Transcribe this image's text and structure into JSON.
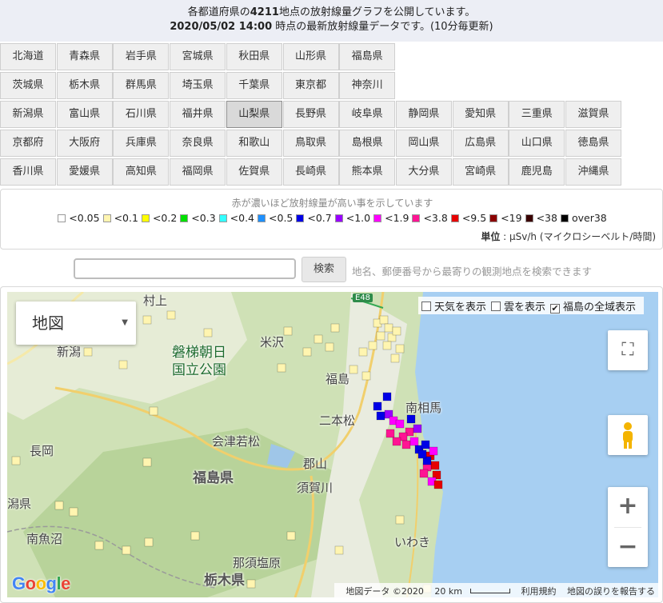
{
  "header": {
    "line1_pre": "各都道府県の",
    "line1_count": "4211",
    "line1_post": "地点の放射線量グラフを公開しています。",
    "line2_datetime": "2020/05/02 14:00",
    "line2_post": " 時点の最新放射線量データです。(10分毎更新)"
  },
  "prefectures": {
    "row1": [
      "北海道",
      "青森県",
      "岩手県",
      "宮城県",
      "秋田県",
      "山形県",
      "福島県"
    ],
    "row2": [
      "茨城県",
      "栃木県",
      "群馬県",
      "埼玉県",
      "千葉県",
      "東京都",
      "神奈川"
    ],
    "row3": [
      "新潟県",
      "富山県",
      "石川県",
      "福井県",
      "山梨県",
      "長野県",
      "岐阜県",
      "静岡県",
      "愛知県",
      "三重県",
      "滋賀県"
    ],
    "row4": [
      "京都府",
      "大阪府",
      "兵庫県",
      "奈良県",
      "和歌山",
      "鳥取県",
      "島根県",
      "岡山県",
      "広島県",
      "山口県",
      "徳島県"
    ],
    "row5": [
      "香川県",
      "愛媛県",
      "高知県",
      "福岡県",
      "佐賀県",
      "長崎県",
      "熊本県",
      "大分県",
      "宮崎県",
      "鹿児島",
      "沖縄県"
    ],
    "active": "山梨県"
  },
  "legend": {
    "caption": "赤が濃いほど放射線量が高い事を示しています",
    "items": [
      {
        "label": "<0.05",
        "color": "#ffffff"
      },
      {
        "label": "<0.1",
        "color": "#fff5b0"
      },
      {
        "label": "<0.2",
        "color": "#ffff00"
      },
      {
        "label": "<0.3",
        "color": "#00e000"
      },
      {
        "label": "<0.4",
        "color": "#33ffff"
      },
      {
        "label": "<0.5",
        "color": "#1e90ff"
      },
      {
        "label": "<0.7",
        "color": "#0000e6"
      },
      {
        "label": "<1.0",
        "color": "#9900ff"
      },
      {
        "label": "<1.9",
        "color": "#ff00ff"
      },
      {
        "label": "<3.8",
        "color": "#ff1493"
      },
      {
        "label": "<9.5",
        "color": "#e60000"
      },
      {
        "label": "<19",
        "color": "#8b0000"
      },
      {
        "label": "<38",
        "color": "#3a0000"
      },
      {
        "label": "over38",
        "color": "#000000"
      }
    ],
    "unit_label": "単位",
    "unit_value": " : μSv/h (マイクロシーベルト/時間)"
  },
  "search": {
    "placeholder": "",
    "button_label": "検索",
    "hint": "地名、郵便番号から最寄りの観測地点を検索できます"
  },
  "map": {
    "type_label": "地図",
    "options": [
      {
        "label": "天気を表示",
        "checked": false
      },
      {
        "label": "雲を表示",
        "checked": false
      },
      {
        "label": "福島の全域表示",
        "checked": true
      }
    ],
    "place_labels": [
      "磐梯朝日",
      "国立公園",
      "米沢",
      "福島",
      "南相馬",
      "二本松",
      "会津若松",
      "長岡",
      "郡山",
      "福島県",
      "須賀川",
      "南魚沼",
      "いわき",
      "那須塩原",
      "栃木県",
      "新潟",
      "村上",
      "潟県"
    ],
    "road_label": "E48",
    "attribution": {
      "data": "地図データ ©2020",
      "scale": "20 km",
      "terms": "利用規約",
      "report": "地図の誤りを報告する"
    },
    "logo": "Google"
  }
}
